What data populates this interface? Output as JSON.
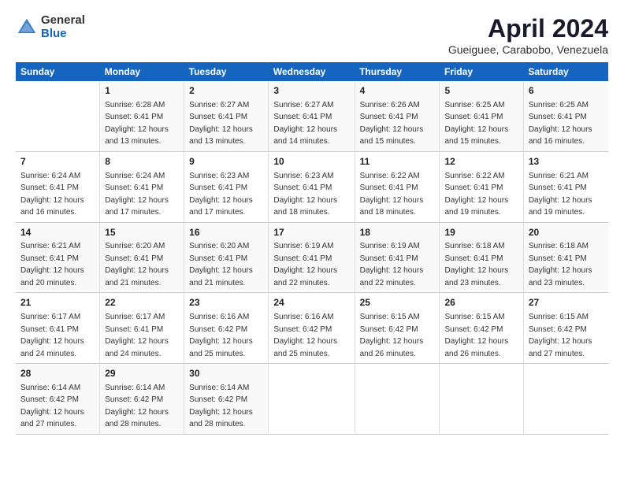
{
  "logo": {
    "general": "General",
    "blue": "Blue"
  },
  "title": "April 2024",
  "subtitle": "Gueiguee, Carabobo, Venezuela",
  "days_header": [
    "Sunday",
    "Monday",
    "Tuesday",
    "Wednesday",
    "Thursday",
    "Friday",
    "Saturday"
  ],
  "weeks": [
    [
      {
        "num": "",
        "sunrise": "",
        "sunset": "",
        "daylight": ""
      },
      {
        "num": "1",
        "sunrise": "Sunrise: 6:28 AM",
        "sunset": "Sunset: 6:41 PM",
        "daylight": "Daylight: 12 hours and 13 minutes."
      },
      {
        "num": "2",
        "sunrise": "Sunrise: 6:27 AM",
        "sunset": "Sunset: 6:41 PM",
        "daylight": "Daylight: 12 hours and 13 minutes."
      },
      {
        "num": "3",
        "sunrise": "Sunrise: 6:27 AM",
        "sunset": "Sunset: 6:41 PM",
        "daylight": "Daylight: 12 hours and 14 minutes."
      },
      {
        "num": "4",
        "sunrise": "Sunrise: 6:26 AM",
        "sunset": "Sunset: 6:41 PM",
        "daylight": "Daylight: 12 hours and 15 minutes."
      },
      {
        "num": "5",
        "sunrise": "Sunrise: 6:25 AM",
        "sunset": "Sunset: 6:41 PM",
        "daylight": "Daylight: 12 hours and 15 minutes."
      },
      {
        "num": "6",
        "sunrise": "Sunrise: 6:25 AM",
        "sunset": "Sunset: 6:41 PM",
        "daylight": "Daylight: 12 hours and 16 minutes."
      }
    ],
    [
      {
        "num": "7",
        "sunrise": "Sunrise: 6:24 AM",
        "sunset": "Sunset: 6:41 PM",
        "daylight": "Daylight: 12 hours and 16 minutes."
      },
      {
        "num": "8",
        "sunrise": "Sunrise: 6:24 AM",
        "sunset": "Sunset: 6:41 PM",
        "daylight": "Daylight: 12 hours and 17 minutes."
      },
      {
        "num": "9",
        "sunrise": "Sunrise: 6:23 AM",
        "sunset": "Sunset: 6:41 PM",
        "daylight": "Daylight: 12 hours and 17 minutes."
      },
      {
        "num": "10",
        "sunrise": "Sunrise: 6:23 AM",
        "sunset": "Sunset: 6:41 PM",
        "daylight": "Daylight: 12 hours and 18 minutes."
      },
      {
        "num": "11",
        "sunrise": "Sunrise: 6:22 AM",
        "sunset": "Sunset: 6:41 PM",
        "daylight": "Daylight: 12 hours and 18 minutes."
      },
      {
        "num": "12",
        "sunrise": "Sunrise: 6:22 AM",
        "sunset": "Sunset: 6:41 PM",
        "daylight": "Daylight: 12 hours and 19 minutes."
      },
      {
        "num": "13",
        "sunrise": "Sunrise: 6:21 AM",
        "sunset": "Sunset: 6:41 PM",
        "daylight": "Daylight: 12 hours and 19 minutes."
      }
    ],
    [
      {
        "num": "14",
        "sunrise": "Sunrise: 6:21 AM",
        "sunset": "Sunset: 6:41 PM",
        "daylight": "Daylight: 12 hours and 20 minutes."
      },
      {
        "num": "15",
        "sunrise": "Sunrise: 6:20 AM",
        "sunset": "Sunset: 6:41 PM",
        "daylight": "Daylight: 12 hours and 21 minutes."
      },
      {
        "num": "16",
        "sunrise": "Sunrise: 6:20 AM",
        "sunset": "Sunset: 6:41 PM",
        "daylight": "Daylight: 12 hours and 21 minutes."
      },
      {
        "num": "17",
        "sunrise": "Sunrise: 6:19 AM",
        "sunset": "Sunset: 6:41 PM",
        "daylight": "Daylight: 12 hours and 22 minutes."
      },
      {
        "num": "18",
        "sunrise": "Sunrise: 6:19 AM",
        "sunset": "Sunset: 6:41 PM",
        "daylight": "Daylight: 12 hours and 22 minutes."
      },
      {
        "num": "19",
        "sunrise": "Sunrise: 6:18 AM",
        "sunset": "Sunset: 6:41 PM",
        "daylight": "Daylight: 12 hours and 23 minutes."
      },
      {
        "num": "20",
        "sunrise": "Sunrise: 6:18 AM",
        "sunset": "Sunset: 6:41 PM",
        "daylight": "Daylight: 12 hours and 23 minutes."
      }
    ],
    [
      {
        "num": "21",
        "sunrise": "Sunrise: 6:17 AM",
        "sunset": "Sunset: 6:41 PM",
        "daylight": "Daylight: 12 hours and 24 minutes."
      },
      {
        "num": "22",
        "sunrise": "Sunrise: 6:17 AM",
        "sunset": "Sunset: 6:41 PM",
        "daylight": "Daylight: 12 hours and 24 minutes."
      },
      {
        "num": "23",
        "sunrise": "Sunrise: 6:16 AM",
        "sunset": "Sunset: 6:42 PM",
        "daylight": "Daylight: 12 hours and 25 minutes."
      },
      {
        "num": "24",
        "sunrise": "Sunrise: 6:16 AM",
        "sunset": "Sunset: 6:42 PM",
        "daylight": "Daylight: 12 hours and 25 minutes."
      },
      {
        "num": "25",
        "sunrise": "Sunrise: 6:15 AM",
        "sunset": "Sunset: 6:42 PM",
        "daylight": "Daylight: 12 hours and 26 minutes."
      },
      {
        "num": "26",
        "sunrise": "Sunrise: 6:15 AM",
        "sunset": "Sunset: 6:42 PM",
        "daylight": "Daylight: 12 hours and 26 minutes."
      },
      {
        "num": "27",
        "sunrise": "Sunrise: 6:15 AM",
        "sunset": "Sunset: 6:42 PM",
        "daylight": "Daylight: 12 hours and 27 minutes."
      }
    ],
    [
      {
        "num": "28",
        "sunrise": "Sunrise: 6:14 AM",
        "sunset": "Sunset: 6:42 PM",
        "daylight": "Daylight: 12 hours and 27 minutes."
      },
      {
        "num": "29",
        "sunrise": "Sunrise: 6:14 AM",
        "sunset": "Sunset: 6:42 PM",
        "daylight": "Daylight: 12 hours and 28 minutes."
      },
      {
        "num": "30",
        "sunrise": "Sunrise: 6:14 AM",
        "sunset": "Sunset: 6:42 PM",
        "daylight": "Daylight: 12 hours and 28 minutes."
      },
      {
        "num": "",
        "sunrise": "",
        "sunset": "",
        "daylight": ""
      },
      {
        "num": "",
        "sunrise": "",
        "sunset": "",
        "daylight": ""
      },
      {
        "num": "",
        "sunrise": "",
        "sunset": "",
        "daylight": ""
      },
      {
        "num": "",
        "sunrise": "",
        "sunset": "",
        "daylight": ""
      }
    ]
  ]
}
